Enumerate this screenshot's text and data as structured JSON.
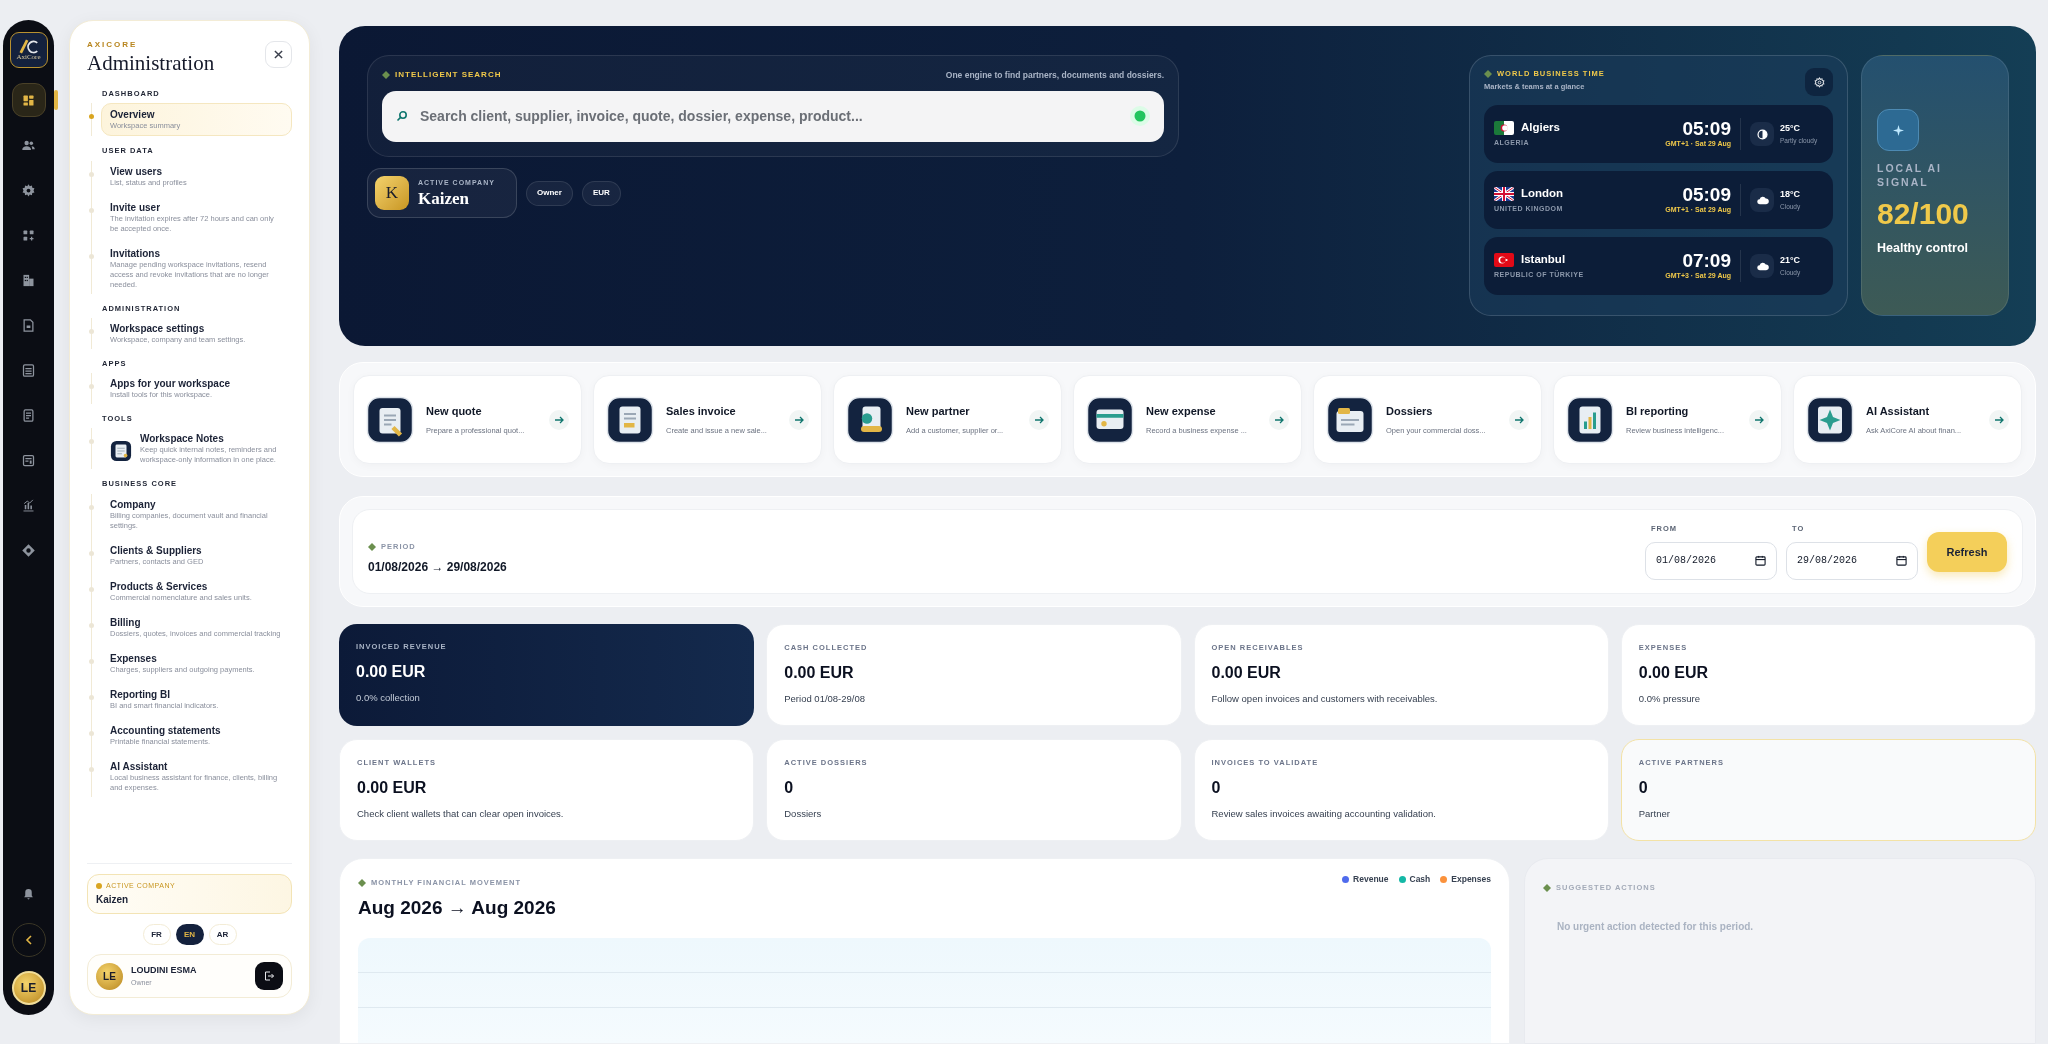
{
  "rail": {
    "logo_text": "AxiCore",
    "items": [
      {
        "selected": true
      },
      {
        "selected": false
      },
      {
        "selected": false
      },
      {
        "selected": false
      },
      {
        "selected": false
      },
      {
        "selected": false
      },
      {
        "selected": false
      },
      {
        "selected": false
      },
      {
        "selected": false
      },
      {
        "selected": false
      },
      {
        "selected": false
      }
    ],
    "avatar": "LE"
  },
  "panel": {
    "brand": "AXICORE",
    "title": "Administration",
    "sections": [
      {
        "heading": "DASHBOARD",
        "items": [
          {
            "title": "Overview",
            "subtitle": "Workspace summary",
            "selected": true
          }
        ]
      },
      {
        "heading": "USER DATA",
        "items": [
          {
            "title": "View users",
            "subtitle": "List, status and profiles",
            "selected": false
          },
          {
            "title": "Invite user",
            "subtitle": "The invitation expires after 72 hours and can only be accepted once.",
            "selected": false
          },
          {
            "title": "Invitations",
            "subtitle": "Manage pending workspace invitations, resend access and revoke invitations that are no longer needed.",
            "selected": false
          }
        ]
      },
      {
        "heading": "ADMINISTRATION",
        "items": [
          {
            "title": "Workspace settings",
            "subtitle": "Workspace, company and team settings.",
            "selected": false
          }
        ]
      },
      {
        "heading": "APPS",
        "items": [
          {
            "title": "Apps for your workspace",
            "subtitle": "Install tools for this workspace.",
            "selected": false
          }
        ]
      },
      {
        "heading": "TOOLS",
        "items": [
          {
            "kind": "app",
            "title": "Workspace Notes",
            "subtitle": "Keep quick internal notes, reminders and workspace-only information in one place.",
            "selected": false
          }
        ]
      },
      {
        "heading": "BUSINESS CORE",
        "items": [
          {
            "title": "Company",
            "subtitle": "Billing companies, document vault and financial settings.",
            "selected": false
          },
          {
            "title": "Clients & Suppliers",
            "subtitle": "Partners, contacts and GED",
            "selected": false
          },
          {
            "title": "Products & Services",
            "subtitle": "Commercial nomenclature and sales units.",
            "selected": false
          },
          {
            "title": "Billing",
            "subtitle": "Dossiers, quotes, invoices and commercial tracking",
            "selected": false
          },
          {
            "title": "Expenses",
            "subtitle": "Charges, suppliers and outgoing payments.",
            "selected": false
          },
          {
            "title": "Reporting BI",
            "subtitle": "BI and smart financial indicators.",
            "selected": false
          },
          {
            "title": "Accounting statements",
            "subtitle": "Printable financial statements.",
            "selected": false
          },
          {
            "title": "AI Assistant",
            "subtitle": "Local business assistant for finance, clients, billing and expenses.",
            "selected": false
          }
        ]
      }
    ],
    "active_company": {
      "label": "ACTIVE COMPANY",
      "name": "Kaizen"
    },
    "languages": [
      {
        "label": "FR",
        "selected": false
      },
      {
        "label": "EN",
        "selected": true
      },
      {
        "label": "AR",
        "selected": false
      }
    ],
    "user": {
      "initials": "LE",
      "name": "LOUDINI ESMA",
      "role": "Owner"
    }
  },
  "hero": {
    "search": {
      "label": "INTELLIGENT SEARCH",
      "tagline": "One engine to find partners, documents and dossiers.",
      "placeholder": "Search client, supplier, invoice, quote, dossier, expense, product..."
    },
    "company": {
      "initial": "K",
      "label": "ACTIVE COMPANY",
      "name": "Kaizen",
      "chips": [
        "Owner",
        "EUR"
      ]
    },
    "world_time": {
      "title": "WORLD BUSINESS TIME",
      "subtitle": "Markets & teams at a glance",
      "cities": [
        {
          "city": "Algiers",
          "country": "ALGERIA",
          "time": "05:09",
          "zone": "GMT+1 · Sat 29 Aug",
          "temp": "25°C",
          "condition": "Partly cloudy"
        },
        {
          "city": "London",
          "country": "UNITED KINGDOM",
          "time": "05:09",
          "zone": "GMT+1 · Sat 29 Aug",
          "temp": "18°C",
          "condition": "Cloudy"
        },
        {
          "city": "Istanbul",
          "country": "REPUBLIC OF TÜRKIYE",
          "time": "07:09",
          "zone": "GMT+3 · Sat 29 Aug",
          "temp": "21°C",
          "condition": "Cloudy"
        }
      ]
    },
    "ai_signal": {
      "label": "LOCAL AI SIGNAL",
      "score": "82/100",
      "status": "Healthy control"
    }
  },
  "quick_actions": [
    {
      "title": "New quote",
      "subtitle": "Prepare a professional quot..."
    },
    {
      "title": "Sales invoice",
      "subtitle": "Create and issue a new sale..."
    },
    {
      "title": "New partner",
      "subtitle": "Add a customer, supplier or..."
    },
    {
      "title": "New expense",
      "subtitle": "Record a business expense ..."
    },
    {
      "title": "Dossiers",
      "subtitle": "Open your commercial doss..."
    },
    {
      "title": "BI reporting",
      "subtitle": "Review business intelligenc..."
    },
    {
      "title": "AI Assistant",
      "subtitle": "Ask AxiCore AI about finan..."
    }
  ],
  "period": {
    "label": "PERIOD",
    "range": "01/08/2026 → 29/08/2026",
    "from_label": "FROM",
    "from": "01/08/2026",
    "to_label": "TO",
    "to": "29/08/2026",
    "refresh": "Refresh"
  },
  "stats": [
    {
      "kind": "dark",
      "label": "INVOICED REVENUE",
      "value": "0.00 EUR",
      "note": "0.0% collection"
    },
    {
      "kind": "plain",
      "label": "CASH COLLECTED",
      "value": "0.00 EUR",
      "note": "Period 01/08-29/08"
    },
    {
      "kind": "plain",
      "label": "OPEN RECEIVABLES",
      "value": "0.00 EUR",
      "note": "Follow open invoices and customers with receivables."
    },
    {
      "kind": "plain",
      "label": "EXPENSES",
      "value": "0.00 EUR",
      "note": "0.0% pressure"
    },
    {
      "kind": "plain",
      "label": "CLIENT WALLETS",
      "value": "0.00 EUR",
      "note": "Check client wallets that can clear open invoices."
    },
    {
      "kind": "plain",
      "label": "ACTIVE DOSSIERS",
      "value": "0",
      "note": "Dossiers"
    },
    {
      "kind": "plain",
      "label": "INVOICES TO VALIDATE",
      "value": "0",
      "note": "Review sales invoices awaiting accounting validation."
    },
    {
      "kind": "gold",
      "label": "ACTIVE PARTNERS",
      "value": "0",
      "note": "Partner"
    }
  ],
  "monthly_movement": {
    "label": "MONTHLY FINANCIAL MOVEMENT",
    "heading": "Aug 2026 → Aug 2026",
    "legend": [
      {
        "label": "Revenue",
        "color": "#4f6bed"
      },
      {
        "label": "Cash",
        "color": "#14b8a6"
      },
      {
        "label": "Expenses",
        "color": "#fb923c"
      }
    ]
  },
  "suggested_actions": {
    "label": "SUGGESTED ACTIONS",
    "message": "No urgent action detected for this period."
  }
}
